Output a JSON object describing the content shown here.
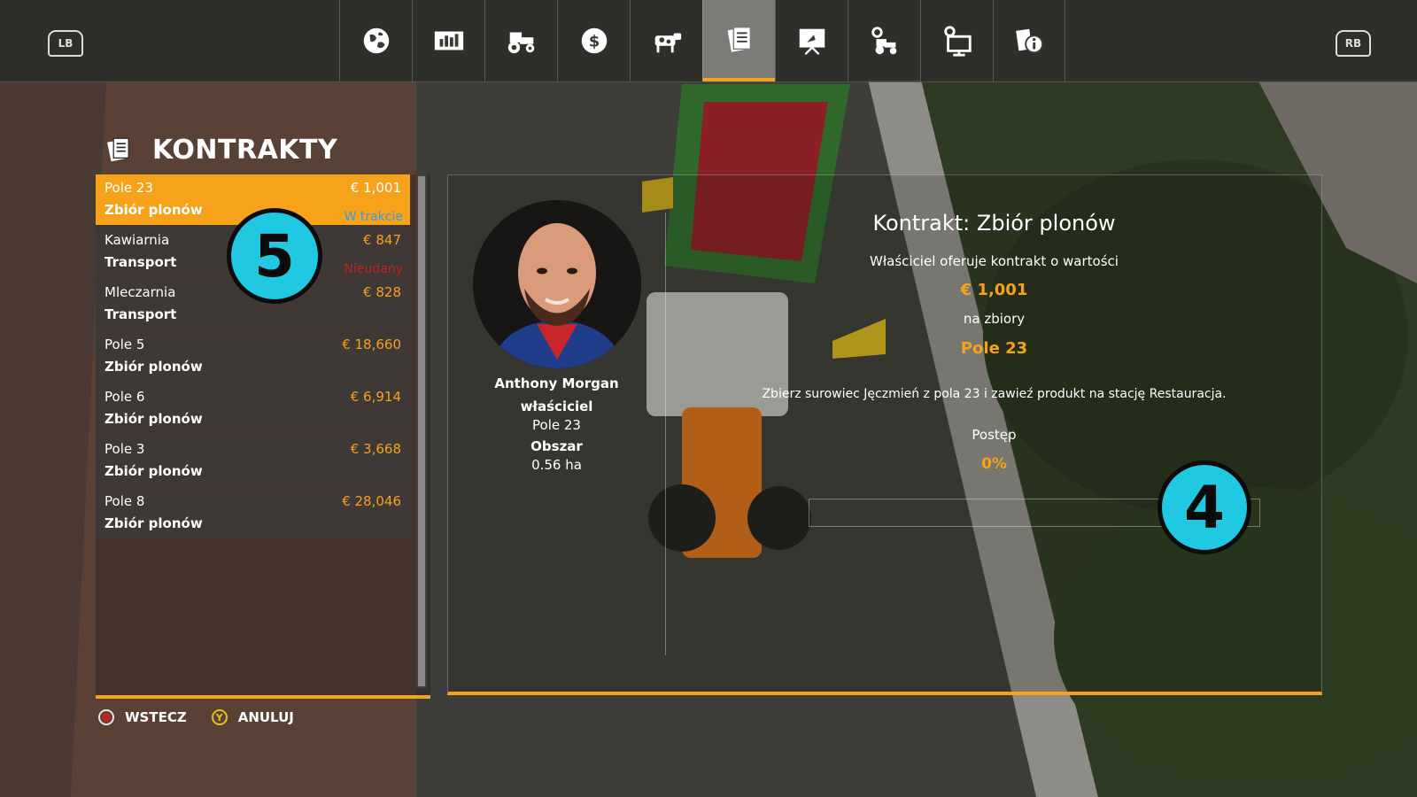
{
  "topbar": {
    "left_bumper": "LB",
    "right_bumper": "RB",
    "tabs": [
      {
        "icon": "globe-icon"
      },
      {
        "icon": "statistics-icon"
      },
      {
        "icon": "tractor-icon"
      },
      {
        "icon": "finances-icon"
      },
      {
        "icon": "cow-icon"
      },
      {
        "icon": "contracts-icon",
        "active": true
      },
      {
        "icon": "presentation-icon"
      },
      {
        "icon": "vehicle-settings-icon"
      },
      {
        "icon": "game-settings-icon"
      },
      {
        "icon": "help-info-icon"
      }
    ]
  },
  "page": {
    "title": "KONTRAKTY"
  },
  "contracts": [
    {
      "name": "Pole 23",
      "type": "Zbiór plonów",
      "price": "€ 1,001",
      "status": "W trakcie",
      "status_color": "#3a9bd9"
    },
    {
      "name": "Kawiarnia",
      "type": "Transport",
      "price": "€ 847",
      "status": "Nieudany",
      "status_color": "#c0231e"
    },
    {
      "name": "Mleczarnia",
      "type": "Transport",
      "price": "€ 828",
      "status": ""
    },
    {
      "name": "Pole 5",
      "type": "Zbiór plonów",
      "price": "€ 18,660",
      "status": ""
    },
    {
      "name": "Pole 6",
      "type": "Zbiór plonów",
      "price": "€ 6,914",
      "status": ""
    },
    {
      "name": "Pole 3",
      "type": "Zbiór plonów",
      "price": "€ 3,668",
      "status": ""
    },
    {
      "name": "Pole 8",
      "type": "Zbiór plonów",
      "price": "€ 28,046",
      "status": ""
    }
  ],
  "detail": {
    "owner_name": "Anthony Morgan",
    "owner_role": "właściciel",
    "owner_field": "Pole 23",
    "area_label": "Obszar",
    "area_value": "0.56 ha",
    "heading": "Kontrakt: Zbiór plonów",
    "offer_text": "Właściciel oferuje kontrakt o wartości",
    "value": "€ 1,001",
    "for_text": "na zbiory",
    "field": "Pole 23",
    "description": "Zbierz surowiec Jęczmień z pola 23 i zawieź produkt na stację Restauracja.",
    "progress_label": "Postęp",
    "progress_text": "0%",
    "progress_fraction": 0
  },
  "annotations": {
    "badge_list": "5",
    "badge_progress": "4"
  },
  "footer": {
    "back_label": "WSTECZ",
    "cancel_label": "ANULUJ",
    "cancel_key": "Y"
  },
  "colors": {
    "accent": "#f7a21b",
    "badge": "#21c8e2",
    "in_progress": "#3a9bd9",
    "failed": "#c0231e"
  }
}
